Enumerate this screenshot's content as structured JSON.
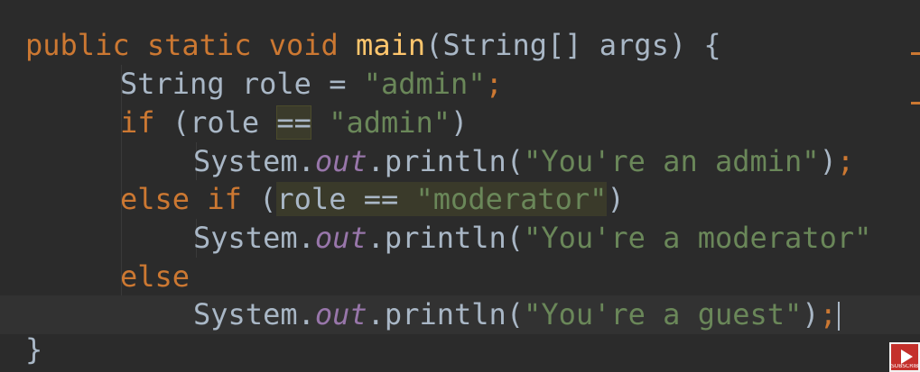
{
  "editor": {
    "lines": [
      {
        "tokens": [
          "public",
          " ",
          "static",
          " ",
          "void",
          " ",
          "main",
          "(String[] args) {"
        ]
      },
      {
        "tokens": [
          "String role = ",
          "\"admin\"",
          ";"
        ]
      },
      {
        "tokens": [
          "if",
          " (role ",
          "==",
          " ",
          "\"admin\"",
          ")"
        ]
      },
      {
        "tokens": [
          "System.",
          "out",
          ".println(",
          "\"You're an admin\"",
          ")",
          ";"
        ]
      },
      {
        "tokens": [
          "else",
          " ",
          "if",
          " (",
          "role == ",
          "\"moderator\"",
          ")"
        ]
      },
      {
        "tokens": [
          "System.",
          "out",
          ".println(",
          "\"You're a moderator\""
        ]
      },
      {
        "tokens": [
          "else"
        ]
      },
      {
        "tokens": [
          "System.",
          "out",
          ".println(",
          "\"You're a guest\"",
          ")",
          ";"
        ]
      },
      {
        "tokens": [
          "}"
        ]
      }
    ]
  },
  "subscribe_overlay": {
    "label": "SUBSCRIBE",
    "icon": "play-icon"
  },
  "colors": {
    "background": "#2b2b2b",
    "current_line": "#323232",
    "keyword": "#cc7832",
    "method": "#ffc66d",
    "string": "#6a8759",
    "field": "#9876aa",
    "plain": "#a9b7c6",
    "youtube_red": "#c4302b"
  }
}
